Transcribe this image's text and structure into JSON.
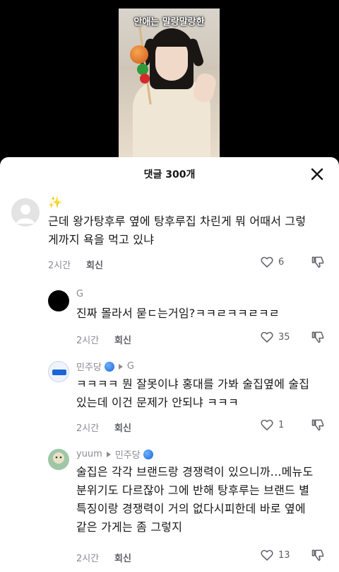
{
  "video": {
    "caption": "안애는 말랑말랑한"
  },
  "header": {
    "title": "댓글 300개"
  },
  "comments": [
    {
      "author": "✨",
      "text_lines": [
        "근데 왕가탕후루 옆에 탕후루집 차린게 뭐 어때서 그렇",
        "게까지 욕을 먹고 있냐"
      ],
      "time": "2시간",
      "reply_label": "회신",
      "likes": "6"
    },
    {
      "author": "G",
      "text_lines": [
        "진짜 몰라서 묻ㄷ는거임?ㅋㅋㄹㅋㅋㄹㅋㄹ"
      ],
      "time": "2시간",
      "reply_label": "회신",
      "likes": "35"
    },
    {
      "author": "민주당",
      "reply_to": "G",
      "text_lines": [
        "ㅋㅋㅋㅋ 뭔 잘못이냐 홍대를 가봐 술집옆에 술집",
        "있는데 이건 문제가 안되냐 ㅋㅋㅋ"
      ],
      "time": "2시간",
      "reply_label": "회신",
      "likes": "1"
    },
    {
      "author": "yuum",
      "reply_to": "민주당",
      "text_lines": [
        "술집은 각각 브랜드랑 경쟁력이 있으니까...메뉴도",
        "분위기도 다르잖아 그에 반해 탕후루는 브랜드 별",
        "특징이랑 경쟁력이 거의 없다시피한데 바로 옆에",
        "같은 가게는 좀 그렇지"
      ],
      "time": "2시간",
      "reply_label": "회신",
      "likes": "13"
    }
  ]
}
